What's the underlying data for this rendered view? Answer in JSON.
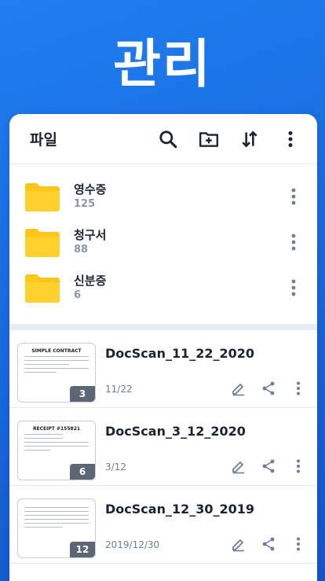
{
  "hero": {
    "title": "관리"
  },
  "toolbar": {
    "title": "파일",
    "icons": [
      "search-icon",
      "new-folder-icon",
      "sort-icon",
      "more-vert-icon"
    ]
  },
  "folders": [
    {
      "name": "영수증",
      "count": "125"
    },
    {
      "name": "청구서",
      "count": "88"
    },
    {
      "name": "신분증",
      "count": "6"
    }
  ],
  "documents": [
    {
      "name": "DocScan_11_22_2020",
      "date": "11/22",
      "pages": "3",
      "thumb_heading": "SIMPLE CONTRACT"
    },
    {
      "name": "DocScan_3_12_2020",
      "date": "3/12",
      "pages": "6",
      "thumb_heading": "RECEIPT #155821"
    },
    {
      "name": "DocScan_12_30_2019",
      "date": "2019/12/30",
      "pages": "12",
      "thumb_heading": ""
    }
  ],
  "colors": {
    "background": "#1a6be0",
    "folder": "#ffc61a",
    "icon": "#1c2333",
    "action_icon": "#6e7d99",
    "badge": "#5d6675"
  }
}
